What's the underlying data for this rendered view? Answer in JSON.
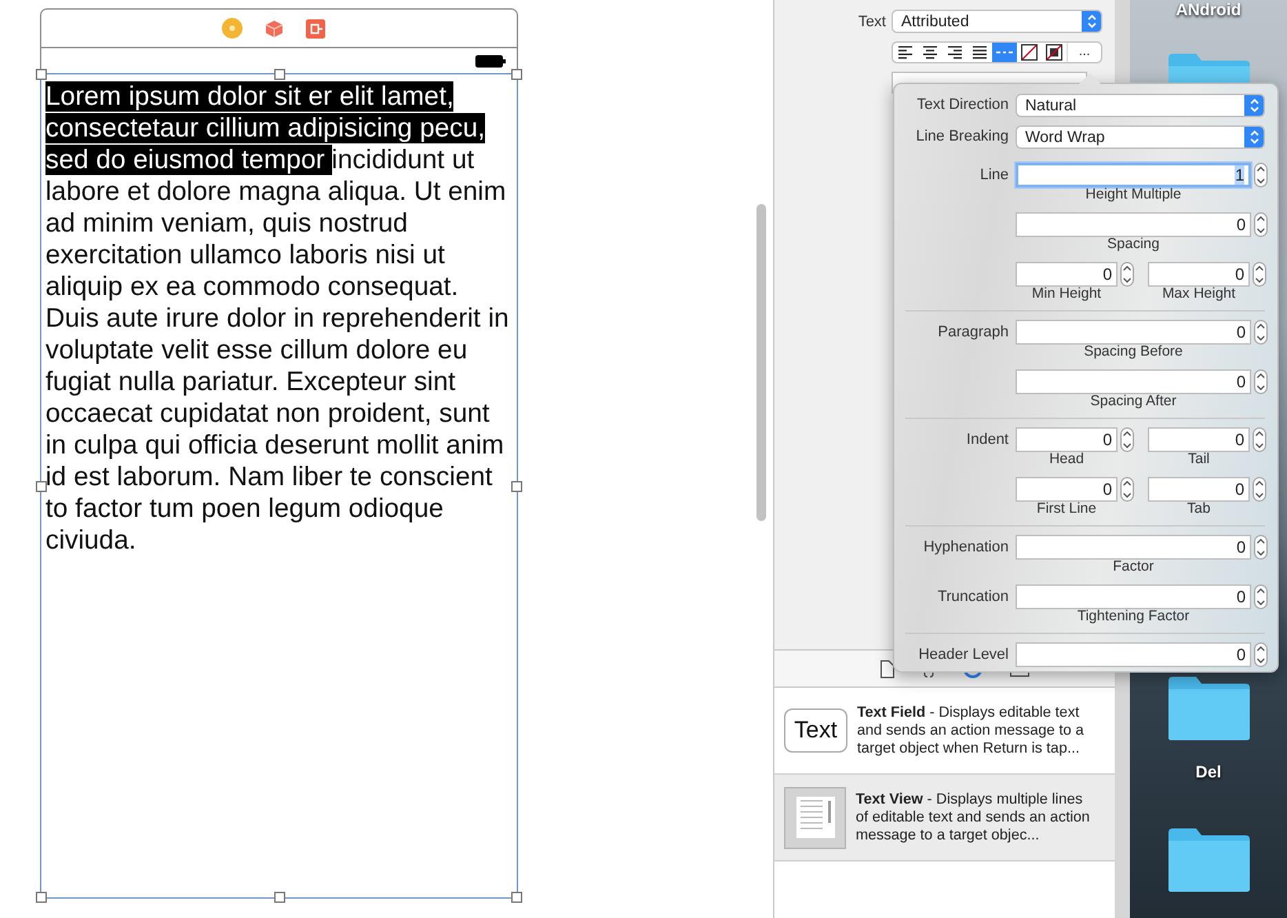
{
  "text_view": {
    "selected_text": "Lorem ipsum dolor sit er elit lamet, consectetaur cillium adipisicing pecu, sed do eiusmod tempor",
    "text": "incididunt ut labore et dolore magna aliqua. Ut enim ad minim veniam, quis nostrud exercitation ullamco laboris nisi ut aliquip ex ea commodo consequat. Duis aute irure dolor in reprehenderit in voluptate velit esse cillum dolore eu fugiat nulla pariatur. Excepteur sint occaecat cupidatat non proident, sunt in culpa qui officia deserunt mollit anim id est laborum. Nam liber te conscient to factor tum poen legum odioque civiuda."
  },
  "inspector": {
    "text_label": "Text",
    "text_type": "Attributed",
    "alignment": [
      {
        "kind": "left",
        "selected": false
      },
      {
        "kind": "center",
        "selected": false
      },
      {
        "kind": "right",
        "selected": false
      },
      {
        "kind": "justify",
        "selected": false
      },
      {
        "kind": "natural",
        "selected": true
      }
    ],
    "more_button": "..."
  },
  "popover": {
    "sections": [
      {
        "rows": [
          {
            "kind": "popup",
            "label": "Text Direction",
            "value": "Natural"
          },
          {
            "kind": "popup",
            "label": "Line Breaking",
            "value": "Word Wrap"
          },
          {
            "kind": "number",
            "label": "Line",
            "fields": [
              {
                "value": "1",
                "caption": "Height Multiple",
                "focused": true
              }
            ]
          },
          {
            "kind": "number",
            "fields": [
              {
                "value": "0",
                "caption": "Spacing",
                "focused": false
              }
            ]
          },
          {
            "kind": "number",
            "fields": [
              {
                "value": "0",
                "caption": "Min Height",
                "focused": false
              },
              {
                "value": "0",
                "caption": "Max Height",
                "focused": false
              }
            ]
          }
        ]
      },
      {
        "rows": [
          {
            "kind": "number",
            "label": "Paragraph",
            "fields": [
              {
                "value": "0",
                "caption": "Spacing Before",
                "focused": false
              }
            ]
          },
          {
            "kind": "number",
            "fields": [
              {
                "value": "0",
                "caption": "Spacing After",
                "focused": false
              }
            ]
          }
        ]
      },
      {
        "rows": [
          {
            "kind": "number",
            "label": "Indent",
            "fields": [
              {
                "value": "0",
                "caption": "Head",
                "focused": false
              },
              {
                "value": "0",
                "caption": "Tail",
                "focused": false
              }
            ]
          },
          {
            "kind": "number",
            "fields": [
              {
                "value": "0",
                "caption": "First Line",
                "focused": false
              },
              {
                "value": "0",
                "caption": "Tab",
                "focused": false
              }
            ]
          }
        ]
      },
      {
        "rows": [
          {
            "kind": "number",
            "label": "Hyphenation",
            "fields": [
              {
                "value": "0",
                "caption": "Factor",
                "focused": false
              }
            ]
          },
          {
            "kind": "number",
            "label": "Truncation",
            "fields": [
              {
                "value": "0",
                "caption": "Tightening Factor",
                "focused": false
              }
            ]
          }
        ]
      },
      {
        "rows": [
          {
            "kind": "number",
            "label": "Header Level",
            "fields": [
              {
                "value": "0",
                "focused": false
              }
            ]
          }
        ]
      }
    ]
  },
  "library": [
    {
      "kind": "text-field",
      "thumb_text": "Text",
      "title": "Text Field",
      "description": "- Displays editable text and sends an action message to a target object when Return is tap...",
      "selected": false
    },
    {
      "kind": "text-view",
      "title": "Text View",
      "description": "- Displays multiple lines of editable text and sends an action message to a target objec...",
      "selected": true
    }
  ],
  "desktop": [
    {
      "kind": "label",
      "text": "ANdroid"
    },
    {
      "kind": "folder"
    },
    {
      "kind": "folder"
    },
    {
      "kind": "label",
      "text": "Del"
    },
    {
      "kind": "folder"
    }
  ]
}
